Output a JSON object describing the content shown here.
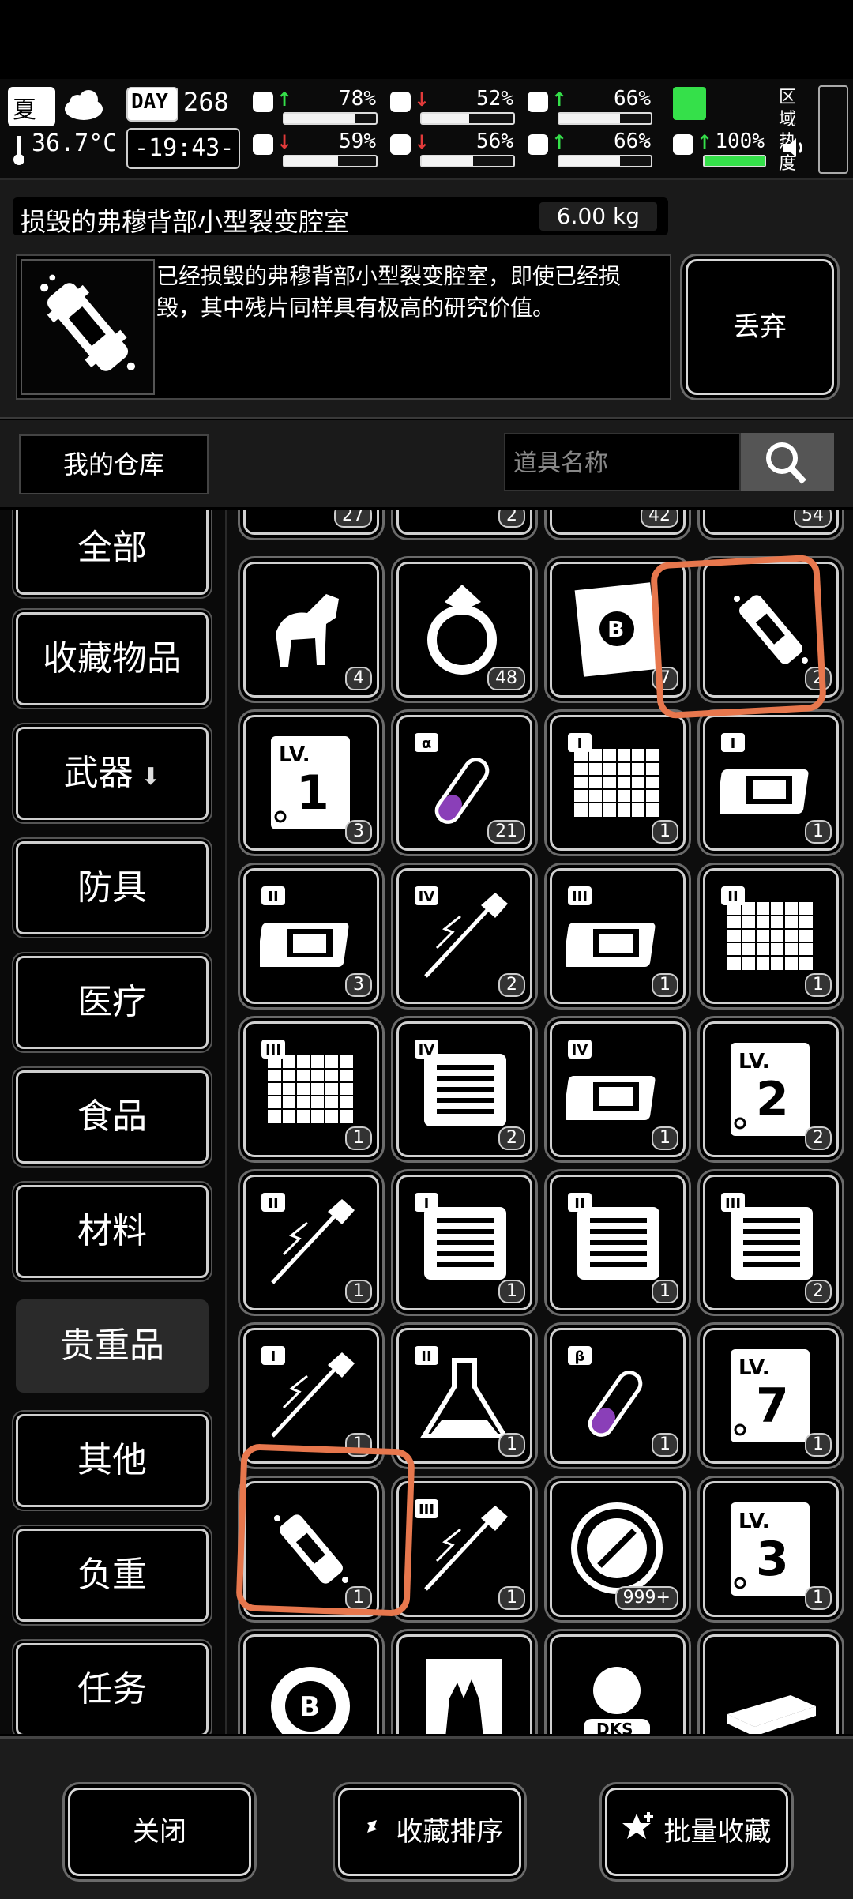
{
  "status": {
    "season": "夏",
    "temperature": "36.7°C",
    "day_label": "DAY",
    "day_number": "268",
    "time": "-19:43-",
    "zone_heat_label": "区域热度",
    "meters": [
      {
        "icon": "medkit-icon",
        "trend": "up",
        "value": "78%",
        "level": 0.78
      },
      {
        "icon": "stomach-icon",
        "trend": "down",
        "value": "52%",
        "level": 0.52
      },
      {
        "icon": "capsule-icon",
        "trend": "up",
        "value": "66%",
        "level": 0.66
      },
      {
        "icon": "brain-icon",
        "trend": "down",
        "value": "59%",
        "level": 0.59
      },
      {
        "icon": "water-drop-icon",
        "trend": "down",
        "value": "56%",
        "level": 0.56
      },
      {
        "icon": "heart-icon",
        "trend": "up",
        "value": "66%",
        "level": 0.66
      },
      {
        "icon": "boot-icon",
        "trend": "up",
        "value": "100%",
        "level": 1.0
      }
    ]
  },
  "selected_item": {
    "name": "损毁的弗穆背部小型裂变腔室",
    "weight": "6.00 kg",
    "description": "已经损毁的弗穆背部小型裂变腔室，即使已经损毁，其中残片同样具有极高的研究价值。",
    "discard_label": "丢弃"
  },
  "warehouse_tab": "我的仓库",
  "search": {
    "placeholder": "道具名称"
  },
  "categories": [
    {
      "label": "全部"
    },
    {
      "label": "收藏物品"
    },
    {
      "label": "武器"
    },
    {
      "label": "防具"
    },
    {
      "label": "医疗"
    },
    {
      "label": "食品"
    },
    {
      "label": "材料"
    },
    {
      "label": "贵重品",
      "active": true
    },
    {
      "label": "其他"
    },
    {
      "label": "负重"
    },
    {
      "label": "任务"
    }
  ],
  "top_partial_counts": [
    "27",
    "2",
    "42",
    "54"
  ],
  "items": [
    {
      "icon": "horse-figurine-icon",
      "count": "4"
    },
    {
      "icon": "ring-icon",
      "count": "48"
    },
    {
      "icon": "b-coin-note-icon",
      "count": "7"
    },
    {
      "icon": "broken-fission-chamber-icon",
      "count": "2"
    },
    {
      "icon": "level-1-card-icon",
      "count": "3",
      "lv": "1"
    },
    {
      "icon": "alpha-test-tube-icon",
      "count": "21",
      "tier": "α"
    },
    {
      "icon": "grid-blueprint-icon",
      "count": "1",
      "tier": "I"
    },
    {
      "icon": "chip-icon",
      "count": "1",
      "tier": "I"
    },
    {
      "icon": "chip-icon",
      "count": "3",
      "tier": "II"
    },
    {
      "icon": "injector-icon",
      "count": "2",
      "tier": "IV"
    },
    {
      "icon": "chip-icon",
      "count": "1",
      "tier": "III"
    },
    {
      "icon": "grid-blueprint-icon",
      "count": "1",
      "tier": "II"
    },
    {
      "icon": "grid-blueprint-icon",
      "count": "1",
      "tier": "III"
    },
    {
      "icon": "module-board-icon",
      "count": "2",
      "tier": "IV"
    },
    {
      "icon": "chip-icon",
      "count": "1",
      "tier": "IV"
    },
    {
      "icon": "level-2-card-icon",
      "count": "2",
      "lv": "2"
    },
    {
      "icon": "injector-icon",
      "count": "1",
      "tier": "II"
    },
    {
      "icon": "module-board-icon",
      "count": "1",
      "tier": "I"
    },
    {
      "icon": "module-board-icon",
      "count": "1",
      "tier": "II"
    },
    {
      "icon": "module-board-icon",
      "count": "2",
      "tier": "III"
    },
    {
      "icon": "injector-icon",
      "count": "1",
      "tier": "I"
    },
    {
      "icon": "flask-icon",
      "count": "1",
      "tier": "II"
    },
    {
      "icon": "beta-test-tube-icon",
      "count": "1",
      "tier": "β"
    },
    {
      "icon": "level-7-card-icon",
      "count": "1",
      "lv": "7"
    },
    {
      "icon": "robot-backpack-icon",
      "count": "1"
    },
    {
      "icon": "injector-icon",
      "count": "1",
      "tier": "III"
    },
    {
      "icon": "wrench-badge-icon",
      "count": "999+"
    },
    {
      "icon": "level-3-card-icon",
      "count": "1",
      "lv": "3"
    },
    {
      "icon": "b-crown-chip-icon",
      "count": ""
    },
    {
      "icon": "zombie-poster-icon",
      "count": ""
    },
    {
      "icon": "dks-mascot-icon",
      "count": ""
    },
    {
      "icon": "cash-bundle-icon",
      "count": ""
    }
  ],
  "bottom_buttons": {
    "close": "关闭",
    "sort": "收藏排序",
    "batch": "批量收藏"
  },
  "colors": {
    "highlight_circle": "#e7774d",
    "up": "#35e04a",
    "down": "#e23a3a"
  }
}
